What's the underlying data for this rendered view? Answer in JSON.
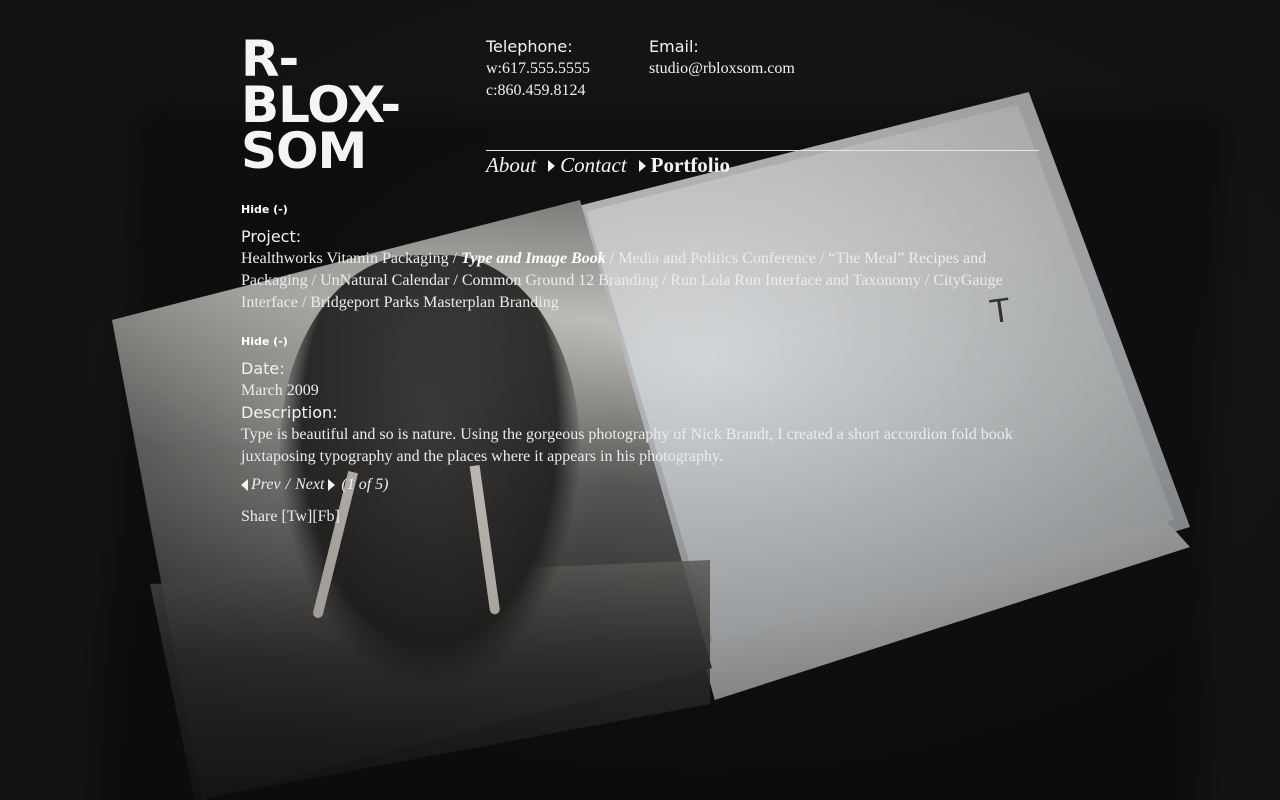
{
  "site": {
    "logo_lines": [
      "R-",
      "BLOX-",
      "SOM"
    ]
  },
  "contact": {
    "telephone_label": "Telephone:",
    "work_phone": "w:617.555.5555",
    "cell_phone": "c:860.459.8124",
    "email_label": "Email:",
    "email": "studio@rbloxsom.com"
  },
  "nav": {
    "items": [
      {
        "label": "About",
        "active": false
      },
      {
        "label": "Contact",
        "active": false
      },
      {
        "label": "Portfolio",
        "active": true
      }
    ]
  },
  "project_section": {
    "hide_label": "Hide (-)",
    "heading": "Project:",
    "projects": [
      {
        "label": "Healthworks Vitamin Packaging",
        "current": false
      },
      {
        "label": "Type and Image Book",
        "current": true
      },
      {
        "label": "Media and Politics Conference",
        "current": false
      },
      {
        "label": "“The Meal” Recipes and Packaging",
        "current": false
      },
      {
        "label": "UnNatural Calendar",
        "current": false
      },
      {
        "label": "Common Ground 12 Branding",
        "current": false
      },
      {
        "label": "Run Lola Run Interface and Taxonomy",
        "current": false
      },
      {
        "label": "CityGauge Interface",
        "current": false
      },
      {
        "label": "Bridgeport Parks Masterplan Branding",
        "current": false
      }
    ],
    "separator": " / "
  },
  "detail_section": {
    "hide_label": "Hide (-)",
    "date_label": "Date:",
    "date": "March 2009",
    "description_label": "Description:",
    "description": "Type is beautiful and so is nature. Using the gorgeous photography of Nick Brandt, I created a short accordion fold book juxtaposing typography and the places where it appears in his photography."
  },
  "pager": {
    "prev": "Prev",
    "separator": "/",
    "next": "Next",
    "position": "(1 of 5)"
  },
  "share": {
    "label": "Share",
    "twitter": "[Tw]",
    "facebook": "[Fb]"
  },
  "background": {
    "page_letter": "T"
  }
}
